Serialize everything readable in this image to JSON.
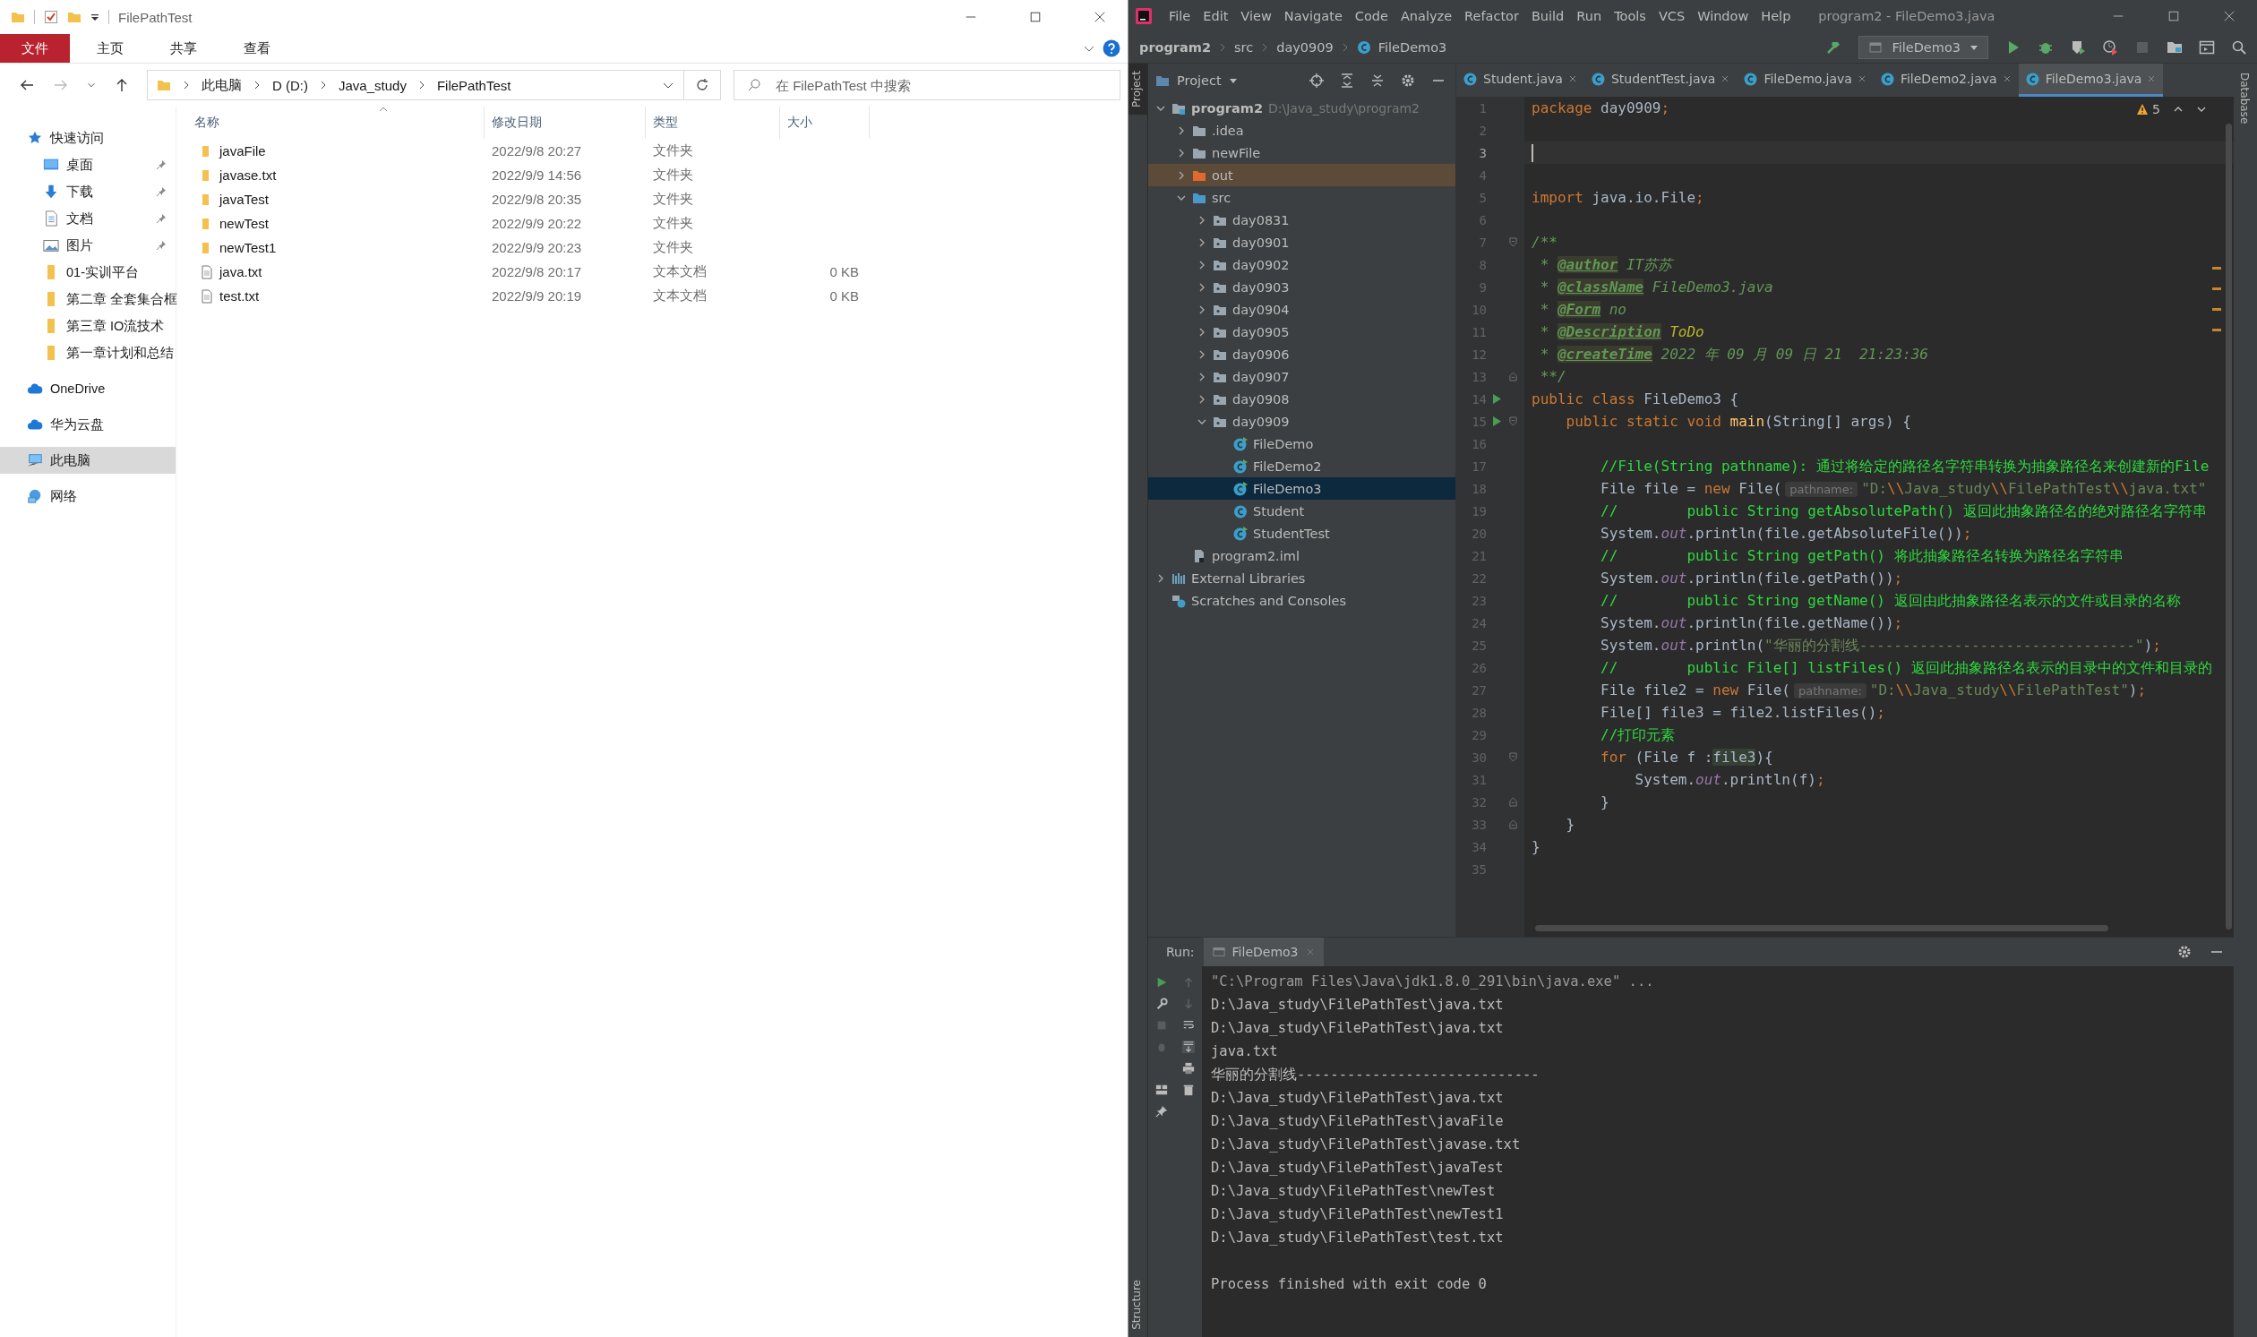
{
  "explorer": {
    "title": "FilePathTest",
    "ribbon": [
      {
        "label": "文件",
        "kind": "menu"
      },
      {
        "label": "主页",
        "kind": "tab"
      },
      {
        "label": "共享",
        "kind": "tab"
      },
      {
        "label": "查看",
        "kind": "tab"
      }
    ],
    "breadcrumb": [
      "此电脑",
      "D (D:)",
      "Java_study",
      "FilePathTest"
    ],
    "search": {
      "placeholder": "在 FilePathTest 中搜索"
    },
    "sidebar": [
      {
        "label": "快速访问",
        "kind": "star",
        "selected": false,
        "children": [
          {
            "label": "桌面",
            "kind": "desktop",
            "pinned": true,
            "selected": false
          },
          {
            "label": "下载",
            "kind": "download",
            "pinned": true,
            "selected": false
          },
          {
            "label": "文档",
            "kind": "document",
            "pinned": true,
            "selected": false
          },
          {
            "label": "图片",
            "kind": "picture",
            "pinned": true,
            "selected": false
          },
          {
            "label": "01-实训平台",
            "kind": "folder",
            "pinned": false,
            "selected": false
          },
          {
            "label": "第二章 全套集合框",
            "kind": "folder",
            "pinned": false,
            "selected": false
          },
          {
            "label": "第三章 IO流技术",
            "kind": "folder",
            "pinned": false,
            "selected": false
          },
          {
            "label": "第一章计划和总结",
            "kind": "folder",
            "pinned": false,
            "selected": false
          }
        ]
      },
      {
        "label": "OneDrive",
        "kind": "cloud",
        "selected": false
      },
      {
        "label": "华为云盘",
        "kind": "cloud",
        "selected": false
      },
      {
        "label": "此电脑",
        "kind": "computer",
        "selected": true
      },
      {
        "label": "网络",
        "kind": "network",
        "selected": false
      }
    ],
    "columns": [
      "名称",
      "修改日期",
      "类型",
      "大小"
    ],
    "files": [
      {
        "name": "javaFile",
        "modified": "2022/9/8 20:27",
        "type": "文件夹",
        "kind": "folder"
      },
      {
        "name": "javase.txt",
        "modified": "2022/9/9 14:56",
        "type": "文件夹",
        "kind": "folder"
      },
      {
        "name": "javaTest",
        "modified": "2022/9/8 20:35",
        "type": "文件夹",
        "kind": "folder"
      },
      {
        "name": "newTest",
        "modified": "2022/9/9 20:22",
        "type": "文件夹",
        "kind": "folder"
      },
      {
        "name": "newTest1",
        "modified": "2022/9/9 20:23",
        "type": "文件夹",
        "kind": "folder"
      },
      {
        "name": "java.txt",
        "modified": "2022/9/8 20:17",
        "type": "文本文档",
        "size": "0 KB",
        "kind": "text"
      },
      {
        "name": "test.txt",
        "modified": "2022/9/9 20:19",
        "type": "文本文档",
        "size": "0 KB",
        "kind": "text"
      }
    ]
  },
  "ide": {
    "menu": [
      "File",
      "Edit",
      "View",
      "Navigate",
      "Code",
      "Analyze",
      "Refactor",
      "Build",
      "Run",
      "Tools",
      "VCS",
      "Window",
      "Help"
    ],
    "title": "program2 - FileDemo3.java",
    "breadcrumb": [
      "program2",
      "src",
      "day0909",
      "FileDemo3"
    ],
    "run_config": "FileDemo3",
    "left_strip": [
      "Project",
      "Structure"
    ],
    "right_strip": "Database",
    "project_title": "Project",
    "tree": [
      {
        "label": "program2",
        "hint": "D:\\Java_study\\program2",
        "kind": "module",
        "expanded": true,
        "selected": false,
        "children": [
          {
            "label": ".idea",
            "kind": "folder",
            "expanded": false,
            "selected": false
          },
          {
            "label": "newFile",
            "kind": "folder",
            "expanded": false,
            "selected": false
          },
          {
            "label": "out",
            "kind": "excluded",
            "expanded": false,
            "selected": false
          },
          {
            "label": "src",
            "kind": "source",
            "expanded": true,
            "selected": false,
            "children": [
              {
                "label": "day0831",
                "kind": "package",
                "expanded": false,
                "selected": false
              },
              {
                "label": "day0901",
                "kind": "package",
                "expanded": false,
                "selected": false
              },
              {
                "label": "day0902",
                "kind": "package",
                "expanded": false,
                "selected": false
              },
              {
                "label": "day0903",
                "kind": "package",
                "expanded": false,
                "selected": false
              },
              {
                "label": "day0904",
                "kind": "package",
                "expanded": false,
                "selected": false
              },
              {
                "label": "day0905",
                "kind": "package",
                "expanded": false,
                "selected": false
              },
              {
                "label": "day0906",
                "kind": "package",
                "expanded": false,
                "selected": false
              },
              {
                "label": "day0907",
                "kind": "package",
                "expanded": false,
                "selected": false
              },
              {
                "label": "day0908",
                "kind": "package",
                "expanded": false,
                "selected": false
              },
              {
                "label": "day0909",
                "kind": "package",
                "expanded": true,
                "selected": false,
                "children": [
                  {
                    "label": "FileDemo",
                    "kind": "main-class",
                    "selected": false
                  },
                  {
                    "label": "FileDemo2",
                    "kind": "main-class",
                    "selected": false
                  },
                  {
                    "label": "FileDemo3",
                    "kind": "main-class",
                    "selected": true
                  },
                  {
                    "label": "Student",
                    "kind": "class",
                    "selected": false
                  },
                  {
                    "label": "StudentTest",
                    "kind": "main-class",
                    "selected": false
                  }
                ]
              }
            ]
          },
          {
            "label": "program2.iml",
            "kind": "iml",
            "selected": false
          }
        ]
      },
      {
        "label": "External Libraries",
        "kind": "libraries",
        "expanded": false,
        "selected": false
      },
      {
        "label": "Scratches and Consoles",
        "kind": "scratches",
        "selected": false
      }
    ],
    "tabs": [
      {
        "label": "Student.java",
        "selected": false
      },
      {
        "label": "StudentTest.java",
        "selected": false
      },
      {
        "label": "FileDemo.java",
        "selected": false
      },
      {
        "label": "FileDemo2.java",
        "selected": false
      },
      {
        "label": "FileDemo3.java",
        "selected": true
      }
    ],
    "warning_count": "5",
    "code": [
      {
        "n": "1",
        "s": [
          {
            "kind": "kw",
            "t": "package "
          },
          {
            "kind": "plain",
            "t": "day0909"
          },
          {
            "kind": "punct",
            "t": ";"
          }
        ]
      },
      {
        "n": "2"
      },
      {
        "n": "3",
        "current": true
      },
      {
        "n": "4"
      },
      {
        "n": "5",
        "s": [
          {
            "kind": "kw",
            "t": "import "
          },
          {
            "kind": "plain",
            "t": "java.io.File"
          },
          {
            "kind": "punct",
            "t": ";"
          }
        ]
      },
      {
        "n": "6"
      },
      {
        "n": "7",
        "kind": "fold-start",
        "s": [
          {
            "kind": "doc",
            "t": "/**"
          }
        ]
      },
      {
        "n": "8",
        "s": [
          {
            "kind": "doc",
            "t": " * "
          },
          {
            "kind": "tag",
            "t": "@author"
          },
          {
            "kind": "doc",
            "t": " IT苏苏"
          }
        ]
      },
      {
        "n": "9",
        "s": [
          {
            "kind": "doc",
            "t": " * "
          },
          {
            "kind": "tag",
            "t": "@className"
          },
          {
            "kind": "doc",
            "t": " FileDemo3.java"
          }
        ]
      },
      {
        "n": "10",
        "s": [
          {
            "kind": "doc",
            "t": " * "
          },
          {
            "kind": "tag",
            "t": "@Form"
          },
          {
            "kind": "doc",
            "t": " no"
          }
        ]
      },
      {
        "n": "11",
        "s": [
          {
            "kind": "doc",
            "t": " * "
          },
          {
            "kind": "tag",
            "t": "@Description"
          },
          {
            "kind": "todo",
            "t": " ToDo"
          }
        ]
      },
      {
        "n": "12",
        "s": [
          {
            "kind": "doc",
            "t": " * "
          },
          {
            "kind": "tag",
            "t": "@createTime"
          },
          {
            "kind": "doc",
            "t": " 2022 年 09 月 09 日 21  21:23:36"
          }
        ]
      },
      {
        "n": "13",
        "kind": "fold-end",
        "s": [
          {
            "kind": "doc",
            "t": " **/"
          }
        ]
      },
      {
        "n": "14",
        "run": true,
        "s": [
          {
            "kind": "kw",
            "t": "public class "
          },
          {
            "kind": "plain",
            "t": "FileDemo3 {"
          }
        ]
      },
      {
        "n": "15",
        "run": true,
        "kind": "fold-start",
        "s": [
          {
            "kind": "kw",
            "t": "    public static void "
          },
          {
            "kind": "method",
            "t": "main"
          },
          {
            "kind": "plain",
            "t": "(String[] args) {"
          }
        ]
      },
      {
        "n": "16"
      },
      {
        "n": "17",
        "s": [
          {
            "kind": "comment",
            "t": "        //File(String pathname): 通过将给定的路径名字符串转换为抽象路径名来创建新的File"
          }
        ]
      },
      {
        "n": "18",
        "s": [
          {
            "kind": "plain",
            "t": "        File file = "
          },
          {
            "kind": "kw",
            "t": "new "
          },
          {
            "kind": "plain",
            "t": "File("
          },
          {
            "kind": "hint",
            "t": "pathname:"
          },
          {
            "kind": "str",
            "t": "\"D:"
          },
          {
            "kind": "esc",
            "t": "\\\\"
          },
          {
            "kind": "str",
            "t": "Java_study"
          },
          {
            "kind": "esc",
            "t": "\\\\"
          },
          {
            "kind": "str",
            "t": "FilePathTest"
          },
          {
            "kind": "esc",
            "t": "\\\\"
          },
          {
            "kind": "str",
            "t": "java.txt\""
          }
        ]
      },
      {
        "n": "19",
        "s": [
          {
            "kind": "comment",
            "t": "        //        public String getAbsolutePath() 返回此抽象路径名的绝对路径名字符串"
          }
        ]
      },
      {
        "n": "20",
        "s": [
          {
            "kind": "plain",
            "t": "        System."
          },
          {
            "kind": "field",
            "t": "out"
          },
          {
            "kind": "plain",
            "t": ".println(file.getAbsoluteFile())"
          },
          {
            "kind": "punct",
            "t": ";"
          }
        ]
      },
      {
        "n": "21",
        "s": [
          {
            "kind": "comment",
            "t": "        //        public String getPath() 将此抽象路径名转换为路径名字符串"
          }
        ]
      },
      {
        "n": "22",
        "s": [
          {
            "kind": "plain",
            "t": "        System."
          },
          {
            "kind": "field",
            "t": "out"
          },
          {
            "kind": "plain",
            "t": ".println(file.getPath())"
          },
          {
            "kind": "punct",
            "t": ";"
          }
        ]
      },
      {
        "n": "23",
        "s": [
          {
            "kind": "comment",
            "t": "        //        public String getName() 返回由此抽象路径名表示的文件或目录的名称"
          }
        ]
      },
      {
        "n": "24",
        "s": [
          {
            "kind": "plain",
            "t": "        System."
          },
          {
            "kind": "field",
            "t": "out"
          },
          {
            "kind": "plain",
            "t": ".println(file.getName())"
          },
          {
            "kind": "punct",
            "t": ";"
          }
        ]
      },
      {
        "n": "25",
        "s": [
          {
            "kind": "plain",
            "t": "        System."
          },
          {
            "kind": "field",
            "t": "out"
          },
          {
            "kind": "plain",
            "t": ".println("
          },
          {
            "kind": "str",
            "t": "\"华丽的分割线--------------------------------\""
          },
          {
            "kind": "plain",
            "t": ")"
          },
          {
            "kind": "punct",
            "t": ";"
          }
        ]
      },
      {
        "n": "26",
        "s": [
          {
            "kind": "comment",
            "t": "        //        public File[] listFiles() 返回此抽象路径名表示的目录中的文件和目录的"
          }
        ]
      },
      {
        "n": "27",
        "s": [
          {
            "kind": "plain",
            "t": "        File file2 = "
          },
          {
            "kind": "kw",
            "t": "new "
          },
          {
            "kind": "plain",
            "t": "File("
          },
          {
            "kind": "hint",
            "t": "pathname:"
          },
          {
            "kind": "str",
            "t": "\"D:"
          },
          {
            "kind": "esc",
            "t": "\\\\"
          },
          {
            "kind": "str",
            "t": "Java_study"
          },
          {
            "kind": "esc",
            "t": "\\\\"
          },
          {
            "kind": "str",
            "t": "FilePathTest\""
          },
          {
            "kind": "plain",
            "t": ")"
          },
          {
            "kind": "punct",
            "t": ";"
          }
        ]
      },
      {
        "n": "28",
        "s": [
          {
            "kind": "plain",
            "t": "        File[] file3 = file2.listFiles()"
          },
          {
            "kind": "punct",
            "t": ";"
          }
        ]
      },
      {
        "n": "29",
        "s": [
          {
            "kind": "comment",
            "t": "        //打印元素"
          }
        ]
      },
      {
        "n": "30",
        "kind": "fold-start",
        "s": [
          {
            "kind": "kw",
            "t": "        for "
          },
          {
            "kind": "plain",
            "t": "(File f :"
          },
          {
            "kind": "usage",
            "t": "file3"
          },
          {
            "kind": "plain",
            "t": "){"
          }
        ]
      },
      {
        "n": "31",
        "s": [
          {
            "kind": "plain",
            "t": "            System."
          },
          {
            "kind": "field",
            "t": "out"
          },
          {
            "kind": "plain",
            "t": ".println(f)"
          },
          {
            "kind": "punct",
            "t": ";"
          }
        ]
      },
      {
        "n": "32",
        "kind": "fold-end",
        "s": [
          {
            "kind": "plain",
            "t": "        }"
          }
        ]
      },
      {
        "n": "33",
        "kind": "fold-end",
        "s": [
          {
            "kind": "plain",
            "t": "    }"
          }
        ]
      },
      {
        "n": "34",
        "s": [
          {
            "kind": "plain",
            "t": "}"
          }
        ]
      },
      {
        "n": "35"
      }
    ],
    "run": {
      "label": "Run:",
      "tab": "FileDemo3",
      "output": [
        {
          "kind": "command",
          "text": "\"C:\\Program Files\\Java\\jdk1.8.0_291\\bin\\java.exe\" ..."
        },
        {
          "kind": "out",
          "text": "D:\\Java_study\\FilePathTest\\java.txt"
        },
        {
          "kind": "out",
          "text": "D:\\Java_study\\FilePathTest\\java.txt"
        },
        {
          "kind": "out",
          "text": "java.txt"
        },
        {
          "kind": "out",
          "text": "华丽的分割线-----------------------------"
        },
        {
          "kind": "out",
          "text": "D:\\Java_study\\FilePathTest\\java.txt"
        },
        {
          "kind": "out",
          "text": "D:\\Java_study\\FilePathTest\\javaFile"
        },
        {
          "kind": "out",
          "text": "D:\\Java_study\\FilePathTest\\javase.txt"
        },
        {
          "kind": "out",
          "text": "D:\\Java_study\\FilePathTest\\javaTest"
        },
        {
          "kind": "out",
          "text": "D:\\Java_study\\FilePathTest\\newTest"
        },
        {
          "kind": "out",
          "text": "D:\\Java_study\\FilePathTest\\newTest1"
        },
        {
          "kind": "out",
          "text": "D:\\Java_study\\FilePathTest\\test.txt"
        },
        {
          "kind": "exit",
          "text": "Process finished with exit code 0"
        }
      ]
    }
  }
}
